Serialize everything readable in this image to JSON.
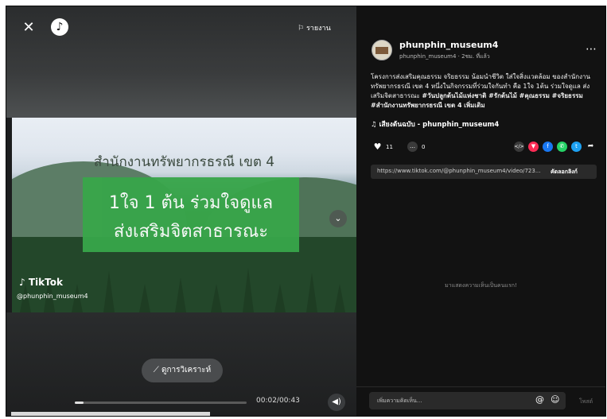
{
  "video": {
    "report_label": "รายงาน",
    "office_title": "สำนักงานทรัพยากรธรณี เขต 4",
    "slogan_line1": "1ใจ 1 ต้น ร่วมใจดูแล",
    "slogan_line2": "ส่งเสริมจิตสาธารณะ",
    "watermark_brand": "TikTok",
    "watermark_handle": "@phunphin_museum4",
    "analytics_label": "ดูการวิเคราะห์",
    "time_label": "00:02/00:43",
    "progress": 0.05
  },
  "post": {
    "username": "phunphin_museum4",
    "submeta": "phunphin_museum4 · 2ชม. ที่แล้ว",
    "caption": "โครงการส่งเสริมคุณธรรม จริยธรรม น้อมนำชีวิต ใส่ใจสิ่งแวดล้อม ของสำนักงานทรัพยากรธรณี เขต 4 หนึ่งในกิจกรรมที่ร่วมใจกันทำ คือ 1ใจ 1ต้น ร่วมใจดูแล ส่งเสริมจิตสาธารณะ",
    "hashtags": "#วันปลูกต้นไม้แห่งชาติ #รักต้นไม้ #คุณธรรม #จริยธรรม #สำนักงานทรัพยากรธรณี เขต 4",
    "see_more": "เพิ่มเติม",
    "music": "♫ เสียงต้นฉบับ - phunphin_museum4",
    "likes": "11",
    "comments": "0",
    "link": "https://www.tiktok.com/@phunphin_museum4/video/723...",
    "copy_link": "คัดลอกลิงก์",
    "empty_comments": "มาแสดงความเห็นเป็นคนแรก!",
    "comment_placeholder": "เพิ่มความคิดเห็น...",
    "post_label": "โพสต์"
  },
  "colors": {
    "embed": "#3a3a3a",
    "share_red": "#fe2c55",
    "facebook": "#1877f2",
    "whatsapp": "#25d366",
    "twitter": "#1da1f2"
  }
}
